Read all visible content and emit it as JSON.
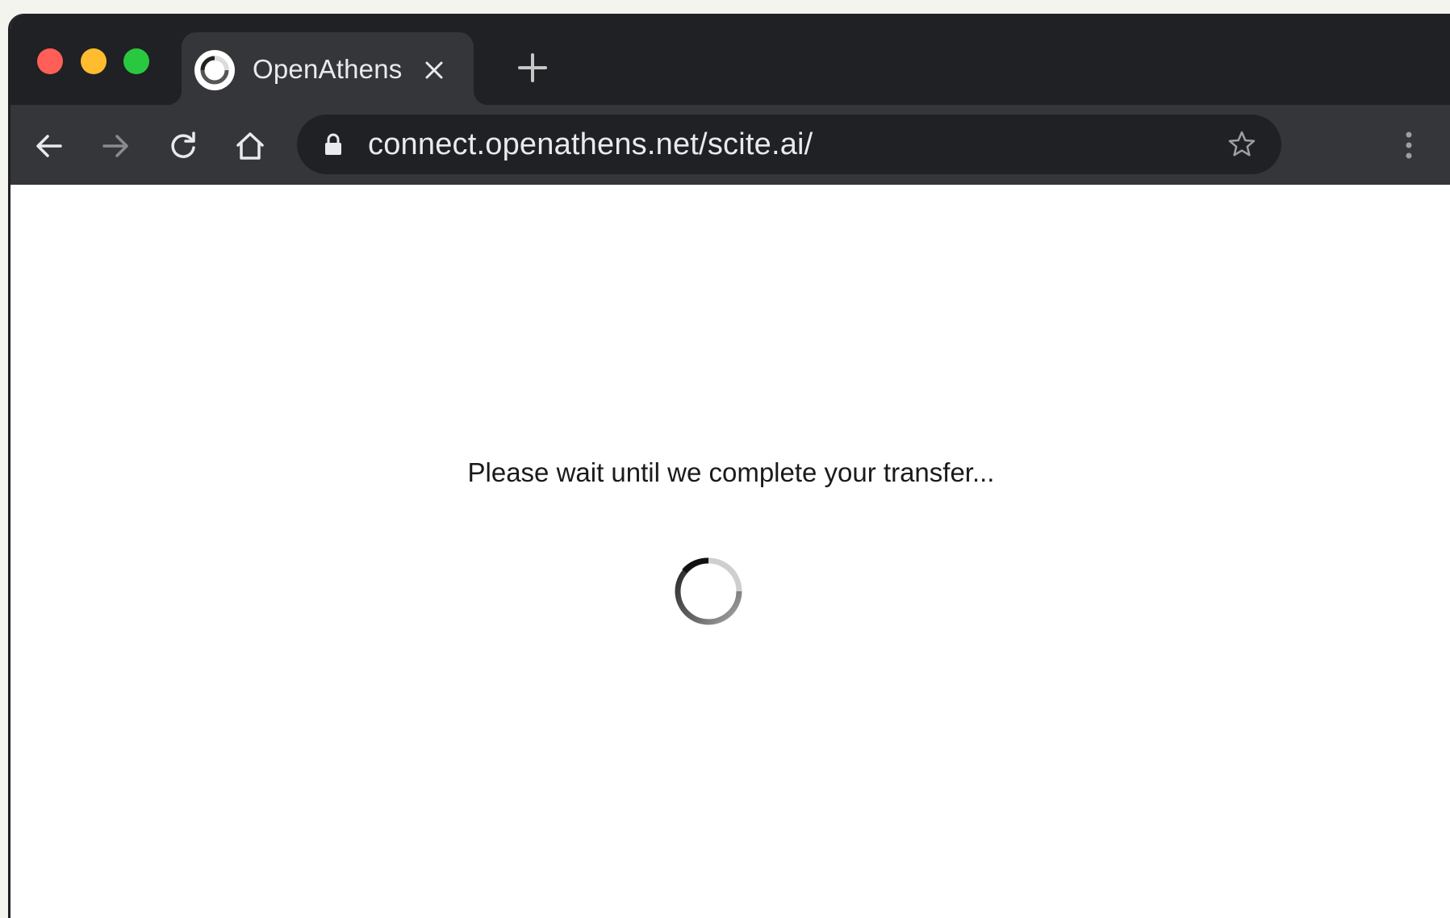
{
  "browser": {
    "tab": {
      "title": "OpenAthens",
      "favicon": "openathens-logo-icon"
    },
    "address_bar": {
      "url": "connect.openathens.net/scite.ai/"
    },
    "icons": {
      "back": "arrow-left-icon",
      "forward": "arrow-right-icon",
      "reload": "reload-icon",
      "home": "home-icon",
      "lock": "lock-icon",
      "bookmark": "star-icon",
      "menu": "vertical-dots-icon",
      "new_tab": "plus-icon",
      "close_tab": "close-icon"
    },
    "colors": {
      "frame": "#202124",
      "toolbar": "#35363a",
      "close": "#ff5f57",
      "minimize": "#febc2e",
      "maximize": "#28c840"
    }
  },
  "page": {
    "message": "Please wait until we complete your transfer...",
    "spinner": "loading-spinner-icon"
  }
}
